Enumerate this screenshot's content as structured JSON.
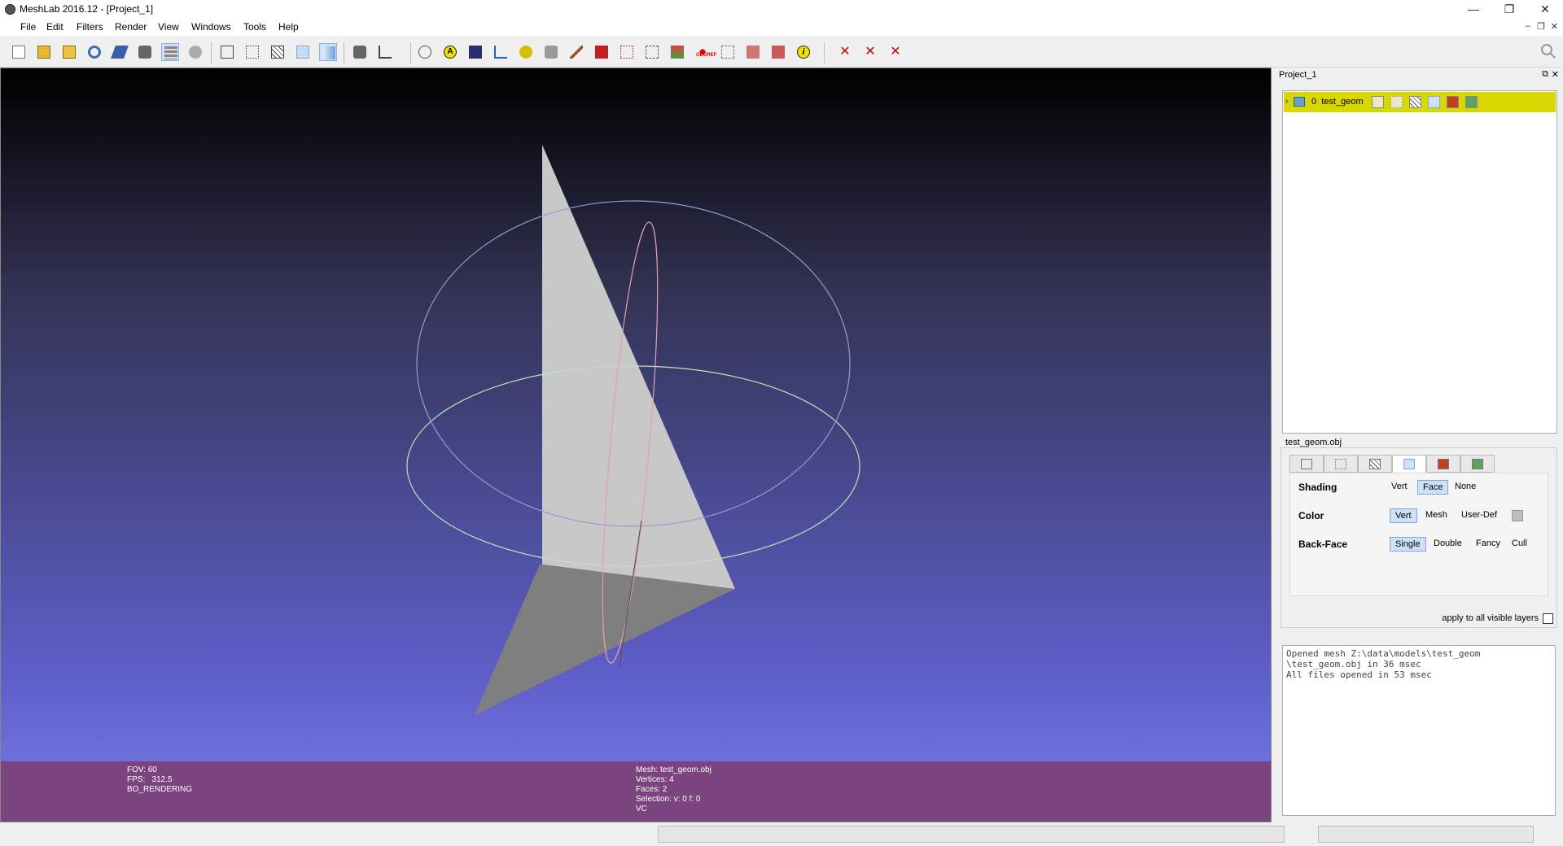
{
  "window": {
    "title": "MeshLab 2016.12 - [Project_1]",
    "controls": [
      "—",
      "❐",
      "✕"
    ],
    "mdi_controls": [
      "–",
      "❐",
      "✕"
    ]
  },
  "menu": [
    "File",
    "Edit",
    "Filters",
    "Render",
    "View",
    "Windows",
    "Tools",
    "Help"
  ],
  "toolbar": {
    "icons": [
      "new-project-icon",
      "open-project-icon",
      "import-mesh-icon",
      "reload-icon",
      "save-icon",
      "snapshot-icon",
      "layers-icon",
      "globe-icon",
      "bounding-box-icon",
      "points-icon",
      "wireframe-icon",
      "flat-lines-icon",
      "smooth-icon",
      "lighting-icon",
      "axis-icon",
      "trackball-icon",
      "annotation-icon",
      "texture-icon",
      "measure-icon",
      "pick-points-icon",
      "pick-color-icon",
      "paint-icon",
      "redbook-icon",
      "align-icon",
      "select-icon",
      "select-faces-icon",
      "georef-icon",
      "select-vertices-icon",
      "select-region-icon",
      "select-cloud-icon",
      "info-icon",
      "delete-vertices-icon",
      "delete-faces-icon",
      "delete-all-icon"
    ],
    "georef_text": "GEOREF"
  },
  "viewport": {
    "info_left": [
      "FOV: 60",
      "FPS:   312.5",
      "BO_RENDERING"
    ],
    "info_mid": [
      "Mesh: test_geom.obj",
      "Vertices: 4",
      "Faces: 2",
      "Selection: v: 0 f: 0",
      "VC"
    ]
  },
  "panel": {
    "title": "Project_1",
    "buttons": [
      "⧉",
      "✕"
    ],
    "layer": {
      "index": "0",
      "name": "test_geom"
    }
  },
  "decorators": {
    "title": "test_geom.obj",
    "shading": {
      "label": "Shading",
      "options": [
        "Vert",
        "Face",
        "None"
      ],
      "selected": "Face"
    },
    "color": {
      "label": "Color",
      "options": [
        "Vert",
        "Mesh",
        "User-Def"
      ],
      "selected": "Vert",
      "swatch": "#bdbdbd"
    },
    "backface": {
      "label": "Back-Face",
      "options": [
        "Single",
        "Double",
        "Fancy",
        "Cull"
      ],
      "selected": "Single"
    },
    "apply_label": "apply to all visible layers"
  },
  "log": [
    "Opened mesh Z:\\data\\models\\test_geom",
    "\\test_geom.obj in 36 msec",
    "All files opened in 53 msec"
  ],
  "colors": {
    "info_bar": "#7c447f",
    "layer_highlight": "#d8d800",
    "mesh_front": "#c8c8c8",
    "mesh_back": "#7f7f7f"
  }
}
